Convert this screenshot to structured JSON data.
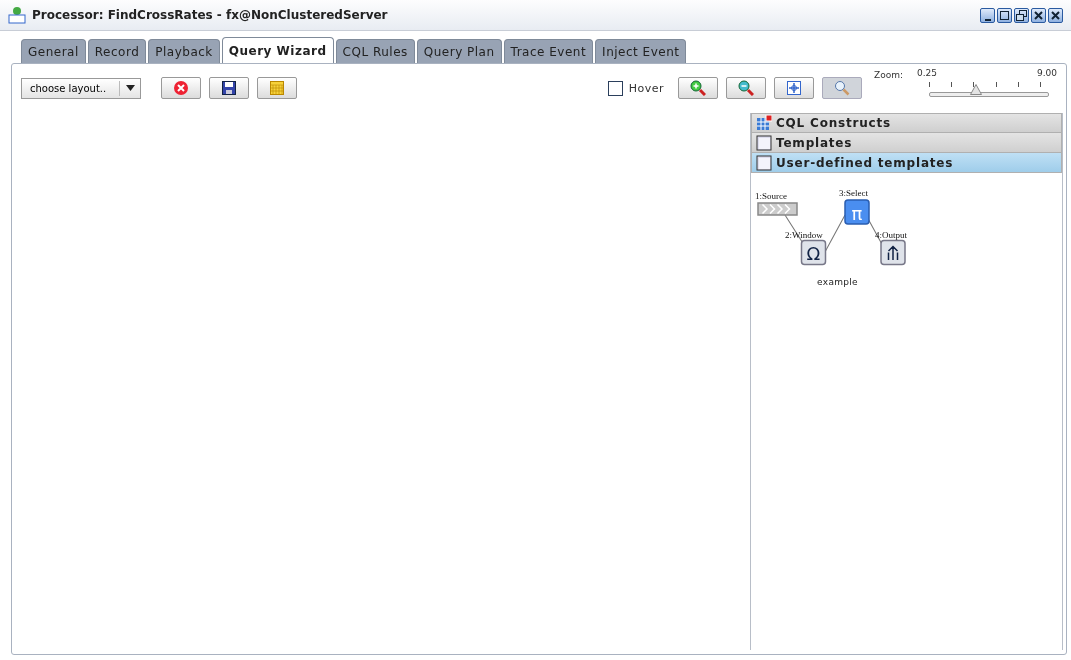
{
  "window": {
    "title": "Processor: FindCrossRates - fx@NonClusteredServer"
  },
  "tabs": [
    {
      "label": "General",
      "selected": false
    },
    {
      "label": "Record",
      "selected": false
    },
    {
      "label": "Playback",
      "selected": false
    },
    {
      "label": "Query Wizard",
      "selected": true
    },
    {
      "label": "CQL Rules",
      "selected": false
    },
    {
      "label": "Query Plan",
      "selected": false
    },
    {
      "label": "Trace Event",
      "selected": false
    },
    {
      "label": "Inject Event",
      "selected": false
    }
  ],
  "toolbar": {
    "layout_dropdown": {
      "value": "choose layout.."
    },
    "hover": {
      "label": "Hover",
      "checked": false
    },
    "zoom": {
      "label": "Zoom:",
      "min": "0.25",
      "max": "9.00",
      "level": 0.39
    }
  },
  "palette": {
    "sections": [
      {
        "label": "CQL Constructs",
        "kind": "grid",
        "selected": false
      },
      {
        "label": "Templates",
        "kind": "folder",
        "selected": false
      },
      {
        "label": "User-defined templates",
        "kind": "folder",
        "selected": true
      }
    ],
    "templates": [
      {
        "name": "example",
        "nodes": [
          {
            "label": "1:Source",
            "kind": "source"
          },
          {
            "label": "2:Window",
            "kind": "window",
            "symbol": "Ω"
          },
          {
            "label": "3:Select",
            "kind": "select",
            "symbol": "π"
          },
          {
            "label": "4:Output",
            "kind": "output"
          }
        ]
      }
    ]
  }
}
